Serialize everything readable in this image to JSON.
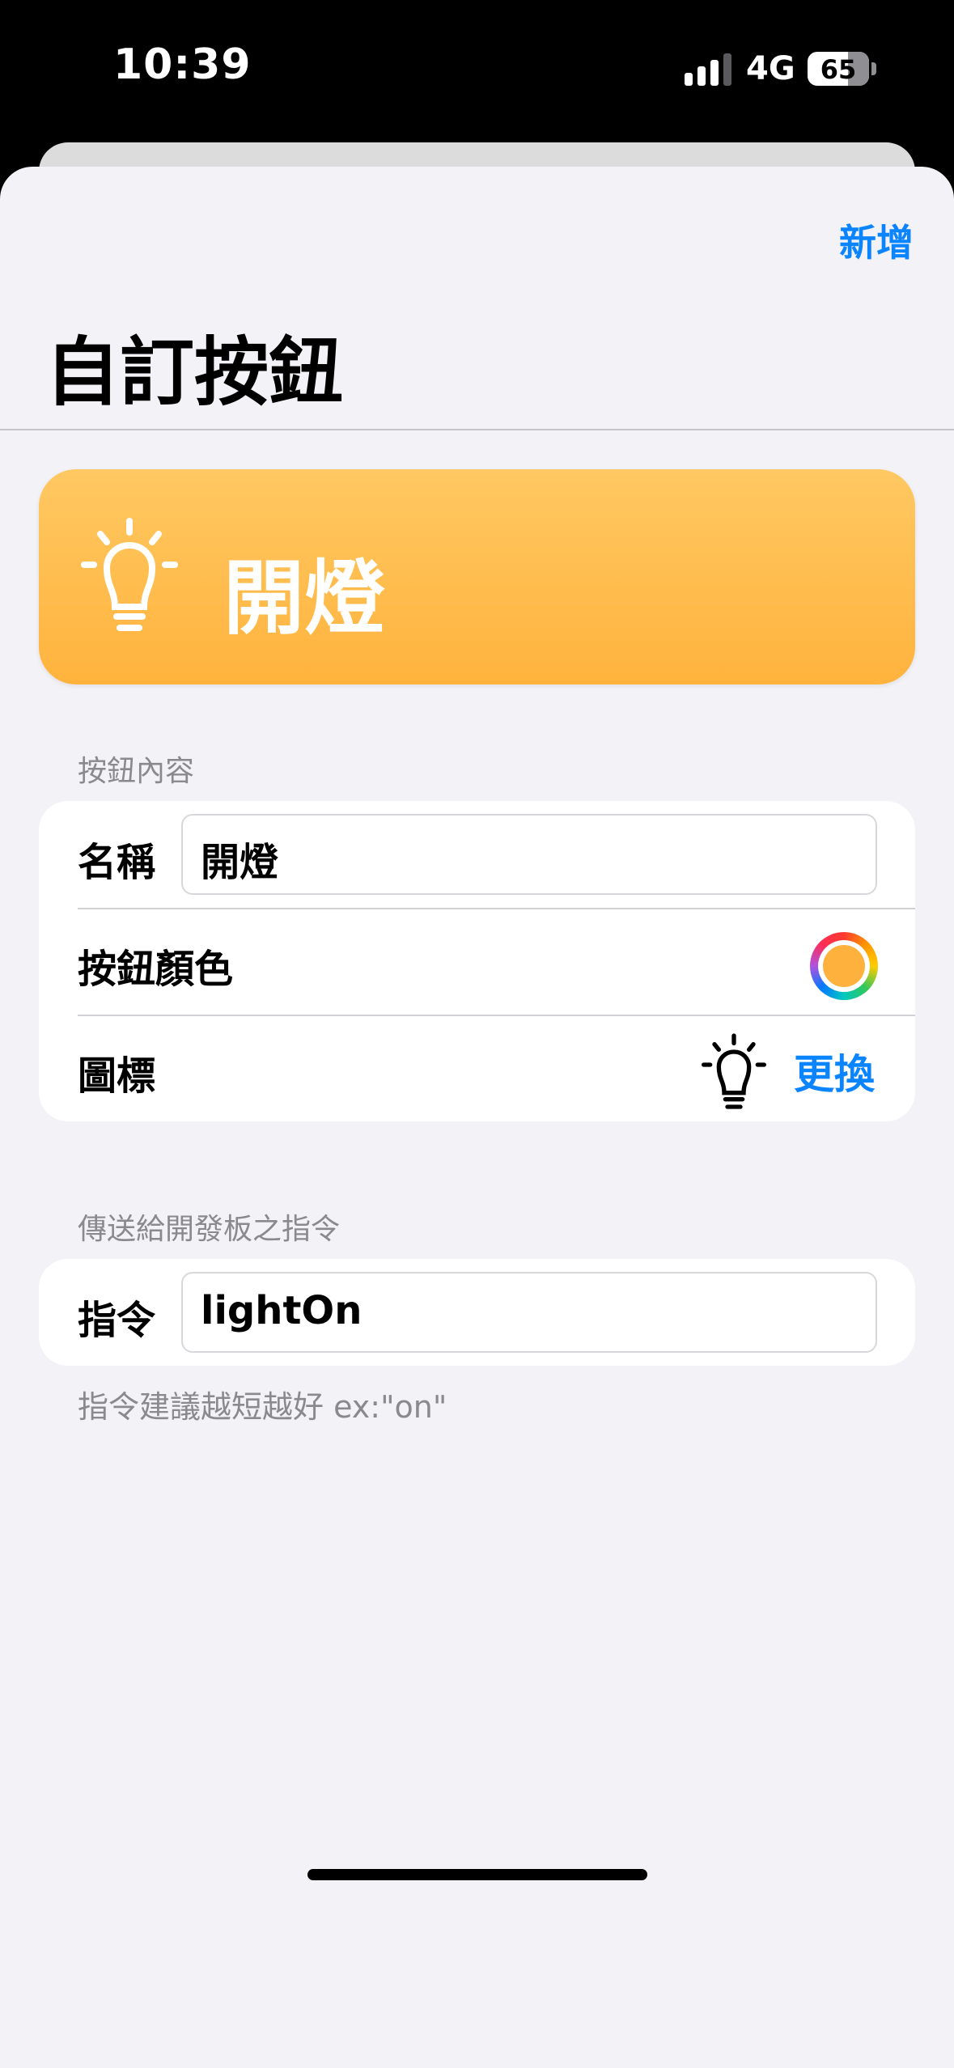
{
  "status_bar": {
    "time": "10:39",
    "network": "4G",
    "battery": "65"
  },
  "header": {
    "add_label": "新增",
    "title": "自訂按鈕"
  },
  "preview": {
    "label": "開燈",
    "icon": "lightbulb-icon",
    "color": "#FFB33D"
  },
  "button_content": {
    "header": "按鈕內容",
    "name_label": "名稱",
    "name_value": "開燈",
    "color_label": "按鈕顏色",
    "color_value": "#FFB13D",
    "icon_label": "圖標",
    "icon_value": "lightbulb-icon",
    "change_label": "更換"
  },
  "command_section": {
    "header": "傳送給開發板之指令",
    "command_label": "指令",
    "command_value": "lightOn",
    "hint": "指令建議越短越好 ex:\"on\""
  },
  "colors": {
    "accent": "#0A84FF",
    "background": "#F2F2F7"
  }
}
